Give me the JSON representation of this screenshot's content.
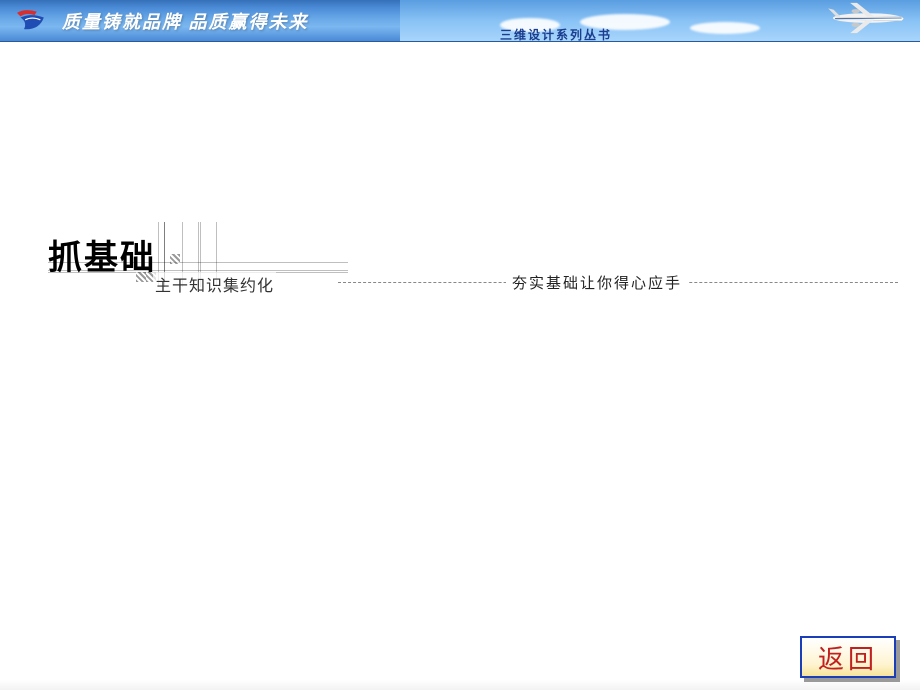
{
  "banner": {
    "slogan": "质量铸就品牌 品质赢得未来",
    "series_label": "三维设计系列丛书"
  },
  "section": {
    "title": "抓基础",
    "subtitle": "主干知识集约化",
    "right_tagline": "夯实基础让你得心应手"
  },
  "controls": {
    "return_label": "返回"
  }
}
